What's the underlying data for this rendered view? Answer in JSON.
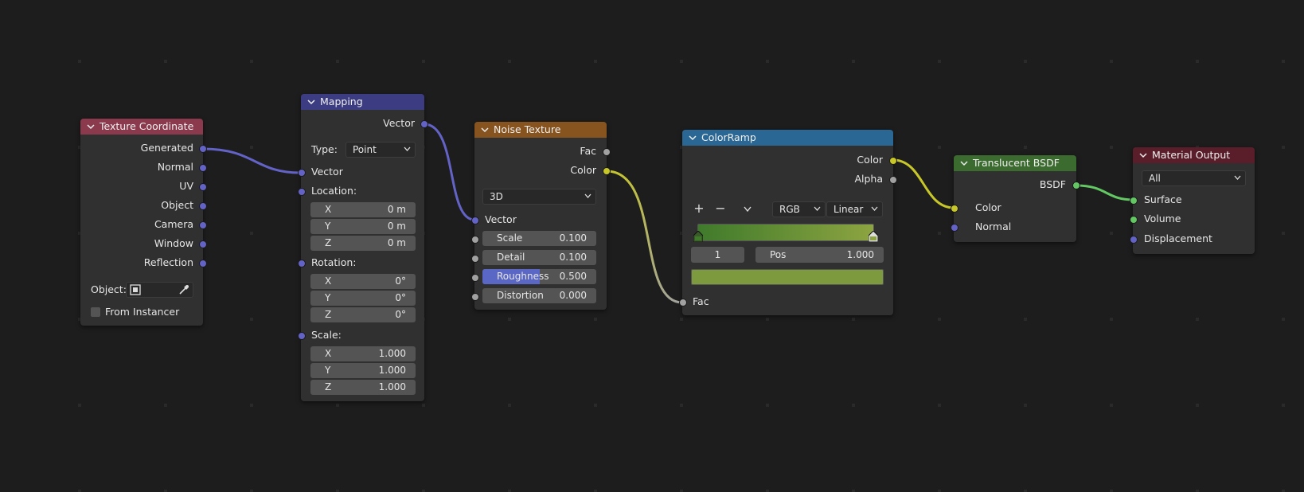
{
  "colors": {
    "background": "#1d1d1d",
    "node_body": "#303030",
    "header_texture_coordinate": "#8a3a4c",
    "header_mapping": "#3c3c83",
    "header_noise_texture": "#87531e",
    "header_colorramp": "#2b6794",
    "header_translucent_bsdf": "#3b6b2f",
    "header_material_output": "#5a1e2a",
    "socket_vector": "#6363c7",
    "socket_float": "#a1a1a1",
    "socket_color": "#c7c729",
    "socket_shader": "#63c763",
    "ramp_left": "#3f7a2b",
    "ramp_right": "#8da441",
    "ramp_swatch": "#7e9a3f"
  },
  "nodes": {
    "texture_coordinate": {
      "title": "Texture Coordinate",
      "outputs": [
        "Generated",
        "Normal",
        "UV",
        "Object",
        "Camera",
        "Window",
        "Reflection"
      ],
      "object_label": "Object:",
      "from_instancer_label": "From Instancer",
      "icons": [
        "object-data-icon",
        "eyedropper-icon"
      ]
    },
    "mapping": {
      "title": "Mapping",
      "output": "Vector",
      "type_label": "Type:",
      "type_value": "Point",
      "input_vector": "Vector",
      "location_label": "Location:",
      "location": [
        {
          "axis": "X",
          "value": "0 m"
        },
        {
          "axis": "Y",
          "value": "0 m"
        },
        {
          "axis": "Z",
          "value": "0 m"
        }
      ],
      "rotation_label": "Rotation:",
      "rotation": [
        {
          "axis": "X",
          "value": "0°"
        },
        {
          "axis": "Y",
          "value": "0°"
        },
        {
          "axis": "Z",
          "value": "0°"
        }
      ],
      "scale_label": "Scale:",
      "scale": [
        {
          "axis": "X",
          "value": "1.000"
        },
        {
          "axis": "Y",
          "value": "1.000"
        },
        {
          "axis": "Z",
          "value": "1.000"
        }
      ]
    },
    "noise_texture": {
      "title": "Noise Texture",
      "outputs": [
        "Fac",
        "Color"
      ],
      "dimension": "3D",
      "input_vector": "Vector",
      "fields": [
        {
          "label": "Scale",
          "value": "0.100"
        },
        {
          "label": "Detail",
          "value": "0.100"
        },
        {
          "label": "Roughness",
          "value": "0.500",
          "fill": 0.5
        },
        {
          "label": "Distortion",
          "value": "0.000"
        }
      ]
    },
    "colorramp": {
      "title": "ColorRamp",
      "outputs": [
        "Color",
        "Alpha"
      ],
      "add_glyph": "+",
      "remove_glyph": "−",
      "color_mode": "RGB",
      "interpolation": "Linear",
      "active_index": "1",
      "pos_label": "Pos",
      "pos_value": "1.000",
      "input_fac": "Fac"
    },
    "translucent_bsdf": {
      "title": "Translucent BSDF",
      "output": "BSDF",
      "inputs": [
        "Color",
        "Normal"
      ]
    },
    "material_output": {
      "title": "Material Output",
      "target": "All",
      "inputs": [
        "Surface",
        "Volume",
        "Displacement"
      ]
    }
  }
}
